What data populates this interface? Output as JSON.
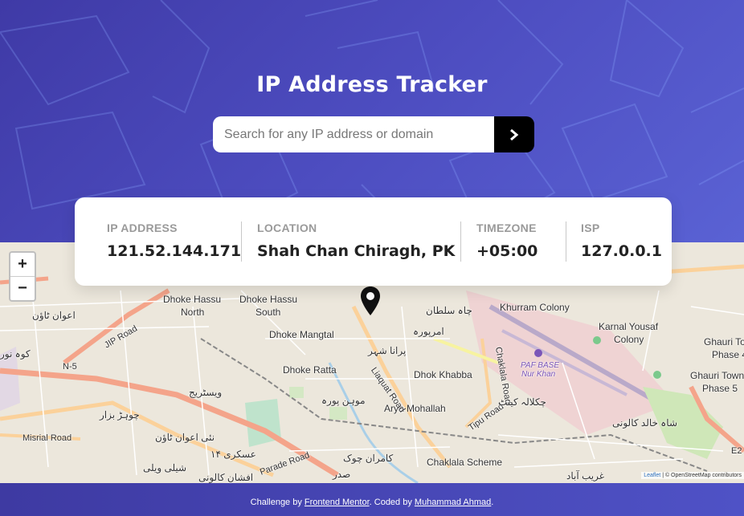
{
  "header": {
    "title": "IP Address Tracker",
    "search_placeholder": "Search for any IP address or domain",
    "submit_icon": "chevron-right-icon"
  },
  "info": {
    "ip_label": "IP ADDRESS",
    "ip_value": "121.52.144.171",
    "location_label": "LOCATION",
    "location_value": "Shah Chan Chiragh, PK",
    "timezone_label": "TIMEZONE",
    "timezone_value": "+05:00",
    "isp_label": "ISP",
    "isp_value": "127.0.0.1"
  },
  "map": {
    "zoom_in": "+",
    "zoom_out": "−",
    "marker_icon": "location-pin-icon",
    "labels": {
      "dhoke_hassu_north_1": "Dhoke Hassu",
      "dhoke_hassu_north_2": "North",
      "dhoke_hassu_south_1": "Dhoke Hassu",
      "dhoke_hassu_south_2": "South",
      "dhoke_mangtal": "Dhoke Mangtal",
      "dhoke_ratta": "Dhoke Ratta",
      "dhok_khabba": "Dhok Khabba",
      "arya_mohallah": "Arya Mohallah",
      "khurram_colony": "Khurram Colony",
      "karnal_yousaf_1": "Karnal Yousaf",
      "karnal_yousaf_2": "Colony",
      "ghauri_town_4_1": "Ghauri To",
      "ghauri_town_4_2": "Phase 4",
      "ghauri_town_5_1": "Ghauri Town",
      "ghauri_town_5_2": "Phase 5",
      "chaklala_scheme": "Chaklala Scheme",
      "paf_base_1": "PAF BASE",
      "paf_base_2": "Nur Khan",
      "n5": "N-5",
      "jip_road": "JIP Road",
      "misrial_road": "Misrial Road",
      "parade_road": "Parade Road",
      "tipu_road": "Tipu Road",
      "chaklala_road": "Chaklala Road",
      "liaquat_road": "Liaquat Road",
      "e2": "E2",
      "ur_awan_town": "اعوان ٹاؤن",
      "ur_koh_noor": "کوہ نور",
      "ur_westridge": "ویسٹریج",
      "ur_chor": "چوہڑ",
      "ur_purana_shehar": "پرانا شہر",
      "ur_amarpura": "امرپورہ",
      "ur_chah_sultan": "چاہ سلطان",
      "ur_mohan_pura": "موہن پورہ",
      "ur_chaklala_cantt": "چکلالہ کینٹ",
      "ur_shah_khalid": "شاہ خالد کالونی",
      "ur_gharib_abad": "غریب آباد",
      "ur_kamran_chowk": "کامران چوک",
      "ur_askari": "عسکری ۱۴",
      "ur_saddar": "صدر",
      "ur_afshan": "افشان کالونی",
      "ur_new_awan": "نئی اعوان ٹاؤن",
      "ur_shehli": "شیلی ویلی",
      "ur_chorr_bazaar": "چوہڑ بزار"
    },
    "attribution_leaflet": "Leaflet",
    "attribution_osm": "| © OpenStreetMap contributors"
  },
  "footer": {
    "challenge_by": "Challenge by",
    "frontend_mentor": "Frontend Mentor",
    "coded_by": ". Coded by",
    "author": "Muhammad Ahmad",
    "end": "."
  }
}
